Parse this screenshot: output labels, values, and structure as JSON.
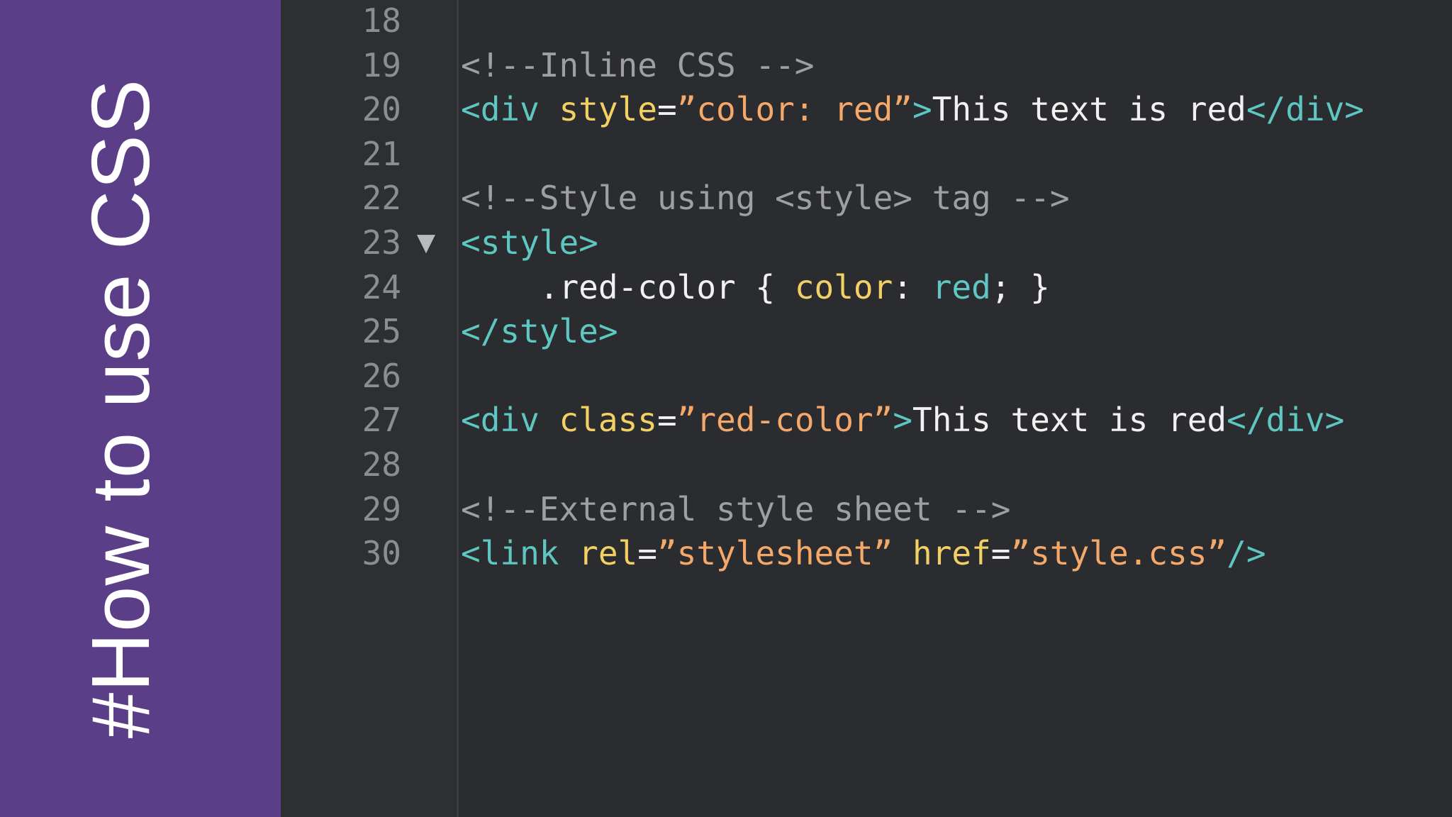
{
  "sidebar": {
    "title": "#How to use CSS"
  },
  "colors": {
    "sidebar_bg": "#5a3f88",
    "editor_bg": "#2b2c2f",
    "tag": "#5fc7c1",
    "attr": "#f2d064",
    "string": "#f4a86a",
    "comment": "#9d9fa4",
    "text": "#f1f1f1"
  },
  "editor": {
    "fold_icon": "triangle-down-icon",
    "fold_glyph": "▼",
    "lines": [
      {
        "n": "18",
        "fold": false,
        "tokens": []
      },
      {
        "n": "19",
        "fold": false,
        "tokens": [
          {
            "t": "comment",
            "v": "<!--Inline CSS -->"
          }
        ]
      },
      {
        "n": "20",
        "fold": false,
        "tokens": [
          {
            "t": "tag",
            "v": "<div "
          },
          {
            "t": "attr",
            "v": "style"
          },
          {
            "t": "punc",
            "v": "="
          },
          {
            "t": "str",
            "v": "”color: red”"
          },
          {
            "t": "tag",
            "v": ">"
          },
          {
            "t": "text",
            "v": "This text is red"
          },
          {
            "t": "tag",
            "v": "</div>"
          }
        ]
      },
      {
        "n": "21",
        "fold": false,
        "tokens": []
      },
      {
        "n": "22",
        "fold": false,
        "tokens": [
          {
            "t": "comment",
            "v": "<!--Style using <style> tag -->"
          }
        ]
      },
      {
        "n": "23",
        "fold": true,
        "tokens": [
          {
            "t": "tag",
            "v": "<style>"
          }
        ]
      },
      {
        "n": "24",
        "fold": false,
        "tokens": [
          {
            "t": "sel",
            "v": "    .red-color "
          },
          {
            "t": "punc",
            "v": "{ "
          },
          {
            "t": "prop",
            "v": "color"
          },
          {
            "t": "punc",
            "v": ": "
          },
          {
            "t": "val",
            "v": "red"
          },
          {
            "t": "punc",
            "v": "; }"
          }
        ]
      },
      {
        "n": "25",
        "fold": false,
        "tokens": [
          {
            "t": "tag",
            "v": "</style>"
          }
        ]
      },
      {
        "n": "26",
        "fold": false,
        "tokens": []
      },
      {
        "n": "27",
        "fold": false,
        "tokens": [
          {
            "t": "tag",
            "v": "<div "
          },
          {
            "t": "attr",
            "v": "class"
          },
          {
            "t": "punc",
            "v": "="
          },
          {
            "t": "str",
            "v": "”red-color”"
          },
          {
            "t": "tag",
            "v": ">"
          },
          {
            "t": "text",
            "v": "This text is red"
          },
          {
            "t": "tag",
            "v": "</div>"
          }
        ]
      },
      {
        "n": "28",
        "fold": false,
        "tokens": []
      },
      {
        "n": "29",
        "fold": false,
        "tokens": [
          {
            "t": "comment",
            "v": "<!--External style sheet -->"
          }
        ]
      },
      {
        "n": "30",
        "fold": false,
        "tokens": [
          {
            "t": "tag",
            "v": "<link "
          },
          {
            "t": "attr",
            "v": "rel"
          },
          {
            "t": "punc",
            "v": "="
          },
          {
            "t": "str",
            "v": "”stylesheet”"
          },
          {
            "t": "punc",
            "v": " "
          },
          {
            "t": "attr",
            "v": "href"
          },
          {
            "t": "punc",
            "v": "="
          },
          {
            "t": "str",
            "v": "”style.css”"
          },
          {
            "t": "tag",
            "v": "/>"
          }
        ]
      }
    ]
  }
}
